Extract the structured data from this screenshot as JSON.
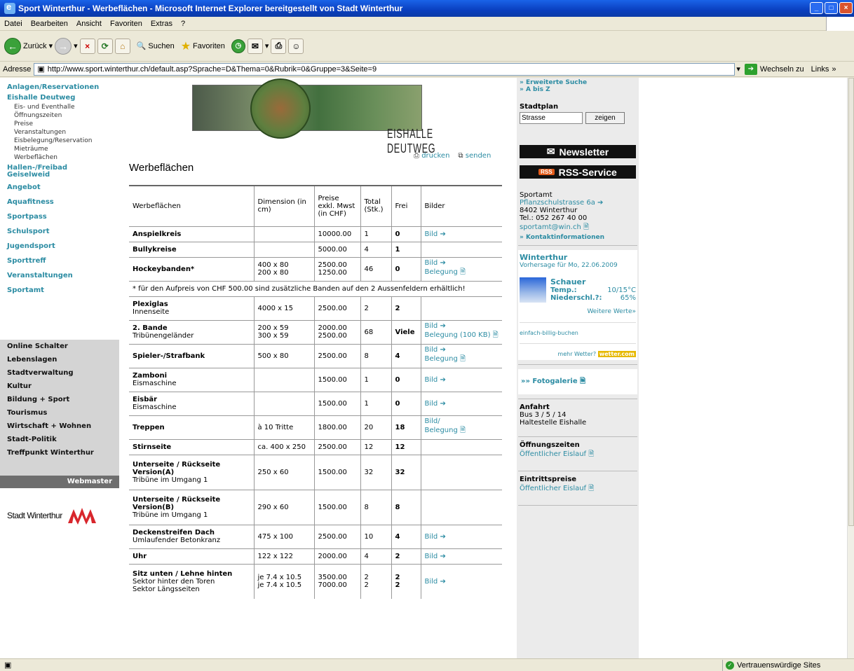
{
  "window": {
    "title": "Sport Winterthur - Werbeflächen - Microsoft Internet Explorer bereitgestellt von Stadt Winterthur"
  },
  "menu": [
    "Datei",
    "Bearbeiten",
    "Ansicht",
    "Favoriten",
    "Extras",
    "?"
  ],
  "toolbar": {
    "back": "Zurück",
    "search": "Suchen",
    "favorites": "Favoriten"
  },
  "address": {
    "label": "Adresse",
    "url": "http://www.sport.winterthur.ch/default.asp?Sprache=D&Thema=0&Rubrik=0&Gruppe=3&Seite=9",
    "go": "Wechseln zu",
    "links": "Links"
  },
  "status": {
    "zone": "Vertrauenswürdige Sites"
  },
  "leftnav": {
    "items": [
      "Anlagen/Reservationen",
      "Eishalle Deutweg"
    ],
    "subitems": [
      "Eis- und Eventhalle",
      "Öffnungszeiten",
      "Preise",
      "Veranstaltungen",
      "Eisbelegung/Reservation",
      "Mieträume",
      "Werbeflächen"
    ],
    "more": [
      "Hallen-/Freibad Geiselweid",
      "Angebot",
      "Aquafitness",
      "Sportpass",
      "Schulsport",
      "Jugendsport",
      "Sporttreff",
      "Veranstaltungen",
      "Sportamt"
    ],
    "grey": [
      "Online Schalter",
      "Lebenslagen",
      "Stadtverwaltung",
      "Kultur",
      "Bildung + Sport",
      "Tourismus",
      "Wirtschaft + Wohnen",
      "Stadt-Politik",
      "Treffpunkt Winterthur"
    ],
    "webmaster": "Webmaster",
    "logo_text": "Stadt Winterthur"
  },
  "main": {
    "banner_title": "EISHALLE DEUTWEG",
    "print": "drucken",
    "send": "senden",
    "title": "Werbeflächen",
    "headers": [
      "Werbeflächen",
      "Dimension (in cm)",
      "Preise exkl. Mwst (in CHF)",
      "Total (Stk.)",
      "Frei",
      "Bilder"
    ],
    "note": "* für den Aufpreis von CHF 500.00 sind zusätzliche Banden auf den 2 Aussenfeldern erhältlich!",
    "rows": [
      {
        "name": "Anspielkreis",
        "sub": "",
        "dim": "",
        "price": "10000.00",
        "total": "1",
        "frei": "0",
        "links": "Bild ➔"
      },
      {
        "name": "Bullykreise",
        "sub": "",
        "dim": "",
        "price": "5000.00",
        "total": "4",
        "frei": "1",
        "links": ""
      },
      {
        "name": "Hockeybanden*",
        "sub": "",
        "dim": "400 x 80\n200 x 80",
        "price": "2500.00\n1250.00",
        "total": "46",
        "frei": "0",
        "links": "Bild ➔\nBelegung 🗎"
      },
      {
        "name": "Plexiglas",
        "sub": "Innenseite",
        "dim": "4000 x 15",
        "price": "2500.00",
        "total": "2",
        "frei": "2",
        "links": ""
      },
      {
        "name": "2. Bande",
        "sub": "Tribünengeländer",
        "dim": "200 x 59\n300 x 59",
        "price": "2000.00\n2500.00",
        "total": "68",
        "frei": "Viele",
        "links": "Bild ➔\nBelegung (100 KB) 🗎"
      },
      {
        "name": "Spieler-/Strafbank",
        "sub": "",
        "dim": "500 x 80",
        "price": "2500.00",
        "total": "8",
        "frei": "4",
        "links": "Bild ➔\nBelegung 🗎"
      },
      {
        "name": "Zamboni",
        "sub": "Eismaschine",
        "dim": "",
        "price": "1500.00",
        "total": "1",
        "frei": "0",
        "links": "Bild ➔"
      },
      {
        "name": "Eisbär",
        "sub": "Eismaschine",
        "dim": "",
        "price": "1500.00",
        "total": "1",
        "frei": "0",
        "links": "Bild ➔"
      },
      {
        "name": "Treppen",
        "sub": "",
        "dim": "à 10 Tritte",
        "price": "1800.00",
        "total": "20",
        "frei": "18",
        "links": "Bild/\nBelegung 🗎"
      },
      {
        "name": "Stirnseite",
        "sub": "",
        "dim": "ca. 400 x 250",
        "price": "2500.00",
        "total": "12",
        "frei": "12",
        "links": ""
      },
      {
        "name": "Unterseite / Rückseite Version(A)",
        "sub": "Tribüne im Umgang 1",
        "dim": "250 x 60",
        "price": "1500.00",
        "total": "32",
        "frei": "32",
        "links": ""
      },
      {
        "name": "Unterseite / Rückseite Version(B)",
        "sub": "Tribüne im Umgang 1",
        "dim": "290 x 60",
        "price": "1500.00",
        "total": "8",
        "frei": "8",
        "links": ""
      },
      {
        "name": "Deckenstreifen Dach",
        "sub": "Umlaufender Betonkranz",
        "dim": "475 x 100",
        "price": "2500.00",
        "total": "10",
        "frei": "4",
        "links": "Bild ➔"
      },
      {
        "name": "Uhr",
        "sub": "",
        "dim": "122 x 122",
        "price": "2000.00",
        "total": "4",
        "frei": "2",
        "links": "Bild ➔"
      },
      {
        "name": "Sitz unten / Lehne hinten",
        "sub": "Sektor hinter den Toren\nSektor Längsseiten",
        "dim": "je 7.4 x 10.5\nje 7.4 x 10.5",
        "price": "3500.00\n7000.00",
        "total": "2\n2",
        "frei": "2\n2",
        "links": "Bild ➔"
      }
    ]
  },
  "right": {
    "search_ext": "» Erweiterte Suche",
    "atoz": "» A bis Z",
    "stadtplan": "Stadtplan",
    "street_placeholder": "Strasse",
    "show": "zeigen",
    "newsletter": "Newsletter",
    "rss": "RSS-Service",
    "rss_badge": "RSS",
    "sportamt": "Sportamt",
    "street": "Pflanzschulstrasse 6a ➔",
    "city": "8402 Winterthur",
    "tel": "Tel.: 052 267 40 00",
    "email": "sportamt@win.ch 🗎",
    "contact": "» Kontaktinformationen",
    "weather_city": "Winterthur",
    "weather_forecast": "Vorhersage für Mo, 22.06.2009",
    "weather_type": "Schauer",
    "temp_label": "Temp.:",
    "temp": "10/15°C",
    "rain_label": "Niederschl.?:",
    "rain": "65%",
    "more_values": "Weitere Werte»",
    "cheap": "einfach-billig-buchen",
    "more_weather": "mehr Wetter?",
    "wetter_com": "wetter.com",
    "gallery": "»» Fotogalerie 🗎",
    "anfahrt": "Anfahrt",
    "bus": "Bus 3 / 5 / 14",
    "stop": "Haltestelle Eishalle",
    "oeffnung": "Öffnungszeiten",
    "oeff_link": "Öffentlicher Eislauf 🗎",
    "eintritt": "Eintrittspreise",
    "eintritt_link": "Öffentlicher Eislauf 🗎"
  }
}
